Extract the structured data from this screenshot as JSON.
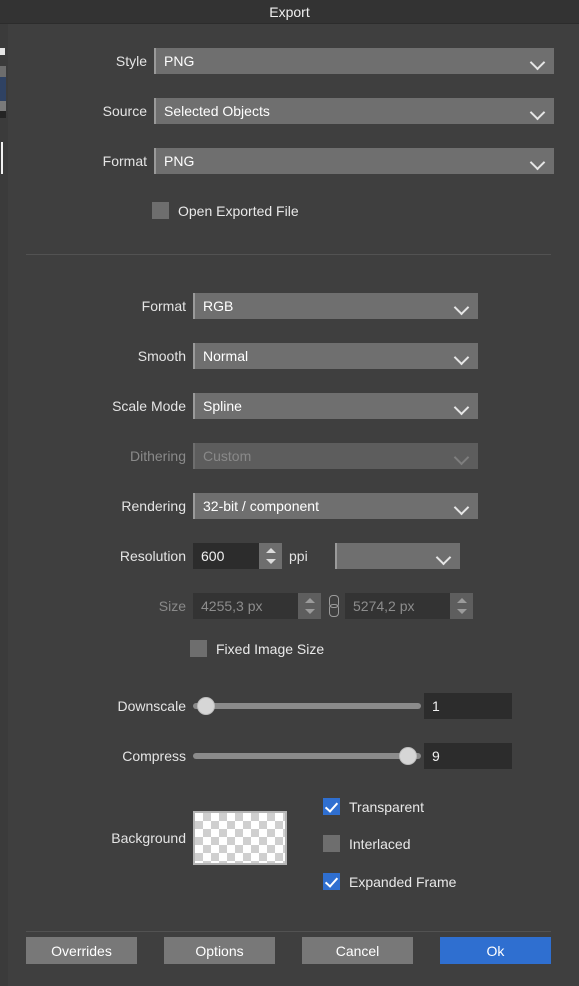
{
  "window": {
    "title": "Export"
  },
  "top_section": {
    "style": {
      "label": "Style",
      "value": "PNG"
    },
    "source": {
      "label": "Source",
      "value": "Selected Objects"
    },
    "format": {
      "label": "Format",
      "value": "PNG"
    },
    "open_exported_file": {
      "label": "Open Exported File",
      "checked": false
    }
  },
  "settings_section": {
    "format": {
      "label": "Format",
      "value": "RGB",
      "disabled": false
    },
    "smooth": {
      "label": "Smooth",
      "value": "Normal",
      "disabled": false
    },
    "scale_mode": {
      "label": "Scale Mode",
      "value": "Spline",
      "disabled": false
    },
    "dithering": {
      "label": "Dithering",
      "value": "Custom",
      "disabled": true
    },
    "rendering": {
      "label": "Rendering",
      "value": "32-bit / component",
      "disabled": false
    },
    "resolution": {
      "label": "Resolution",
      "value": "600",
      "unit": "ppi",
      "preset_value": "",
      "disabled": false
    },
    "size": {
      "label": "Size",
      "width_value": "4255,3 px",
      "height_value": "5274,2 px",
      "link_icon": "chain-link-icon",
      "disabled": true
    },
    "fixed_image_size": {
      "label": "Fixed Image Size",
      "checked": false
    },
    "downscale": {
      "label": "Downscale",
      "value": "1",
      "percent": 2,
      "min": 1,
      "max": 100
    },
    "compress": {
      "label": "Compress",
      "value": "9",
      "percent": 98,
      "min": 0,
      "max": 9
    }
  },
  "background_section": {
    "label": "Background",
    "swatch": "transparent-checkerboard",
    "transparent": {
      "label": "Transparent",
      "checked": true
    },
    "interlaced": {
      "label": "Interlaced",
      "checked": false
    },
    "expanded_frame": {
      "label": "Expanded Frame",
      "checked": true
    }
  },
  "buttons": {
    "overrides": "Overrides",
    "options": "Options",
    "cancel": "Cancel",
    "ok": "Ok"
  },
  "colors": {
    "dialog_bg": "#3f3f3f",
    "titlebar_bg": "#333333",
    "combo_bg": "#6f6f6f",
    "input_bg": "#2c2c2c",
    "accent": "#2f6fd0",
    "button_bg": "#787878",
    "disabled_text": "#8a8a8a"
  }
}
